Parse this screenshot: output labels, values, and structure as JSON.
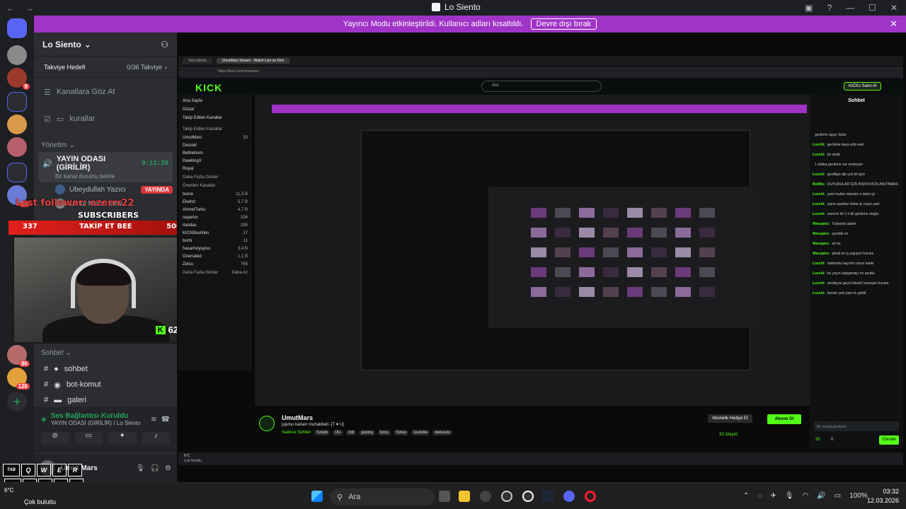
{
  "window": {
    "title": "Lo Siento",
    "nav_back": "←",
    "nav_forward": "→"
  },
  "banner": {
    "text": "Yayıncı Modu etkinleştirildi. Kullanıcı adları kısaltıldı.",
    "button": "Devre dışı bırak",
    "close": "✕"
  },
  "server": {
    "name": "Lo Siento",
    "boost_goal": "Takviye Hedefi",
    "boost_count": "0/36 Takviye",
    "browse_channels": "Kanallara Göz At",
    "rules_channel": "kurallar",
    "category_admin": "Yönetim",
    "voice_channel": "YAYIN ODASI (GİRİLİR)",
    "voice_timer": "9:11:26",
    "voice_status": "Bir kanal durumu belirle",
    "members": [
      {
        "name": "Ubeydullah Yazıcı",
        "badge": "YAYINDA"
      },
      {
        "name": "Umut Mars",
        "badge": "BMW"
      }
    ],
    "category_chat": "Sohbet",
    "text_channels": [
      "sohbet",
      "bot-komut",
      "galeri"
    ]
  },
  "voice_connection": {
    "status": "Ses Bağlantısı Kuruldu",
    "location": "YAYIN ODASI (GİRİLİR) / Lo Siento"
  },
  "user_panel": {
    "name": "Umut Mars",
    "status": "Çok bulutlu"
  },
  "overlay": {
    "last_follower": "Last follower: ozerrr22",
    "subscribers_label": "SUBSCRIBERS",
    "sub_count": "337",
    "follow_goal_label": "TAKİP ET BEE",
    "follow_goal": "500",
    "bilgi": "Bilgi",
    "kick_viewers": "62"
  },
  "kick": {
    "tab1": "Yeni sekme",
    "tab2": "UmutMars Stream - Watch Live on Kick",
    "url": "https://kick.com/umutmars",
    "logo": "KICK",
    "search_placeholder": "Ara",
    "nav": [
      "Ana Sayfa",
      "Gözat",
      "Takip Edilen Kanallar"
    ],
    "followed_header": "Takip Edilen Kanallar",
    "followed": [
      {
        "name": "UmutMars",
        "sub": "Sadece Sohbet",
        "count": "33"
      },
      {
        "name": "Dessiel",
        "sub": "",
        "count": ""
      },
      {
        "name": "Bethlehem",
        "sub": "",
        "count": ""
      },
      {
        "name": "DwellingX",
        "sub": "",
        "count": ""
      },
      {
        "name": "Royal",
        "sub": "",
        "count": ""
      }
    ],
    "more": "Daha Fazla Göster",
    "recommended_header": "Önerilen Kanallar",
    "recommended": [
      {
        "name": "burce",
        "sub": "Sadece Sohbet",
        "count": "11,3 B"
      },
      {
        "name": "Elwind",
        "sub": "League of Legends",
        "count": "5,7 B"
      },
      {
        "name": "AhmetTurku",
        "sub": "Grand Theft Auto V",
        "count": "4,7 B"
      },
      {
        "name": "superior",
        "sub": "PUBG: Battlegrounds",
        "count": "334"
      },
      {
        "name": "rlandas",
        "sub": "",
        "count": "285"
      },
      {
        "name": "KICKBounties",
        "sub": "KICK Bounties",
        "count": "17"
      },
      {
        "name": "burhi",
        "sub": "Resident Evil Requiem",
        "count": "11"
      },
      {
        "name": "hasamviyuyivu",
        "sub": "Counter-Strike 2",
        "count": "3,4 B"
      },
      {
        "name": "Overrated",
        "sub": "Teamfight Tactics",
        "count": "1,1 B"
      },
      {
        "name": "Zetsu",
        "sub": "Sadece Sohbet",
        "count": "765"
      }
    ],
    "less": "Daha Fazla Göster",
    "less2": "Daha Az",
    "kicks_button": "KICKs Satın Al",
    "streamer": "UmutMars",
    "stream_title": "jujutsu kaisen muhabbeti -[T ♥ U]",
    "category": "Sadece Sohbet",
    "tags": [
      "Turkish",
      "18+",
      "chill",
      "gaming",
      "funny",
      "Türkçe",
      "Soulslike",
      "darksouls"
    ],
    "viewers": "33 İzleyici",
    "gift_button": "Abonelik Hediye Et",
    "subscribe_button": "Abone Ol",
    "chat_header": "Sohbet",
    "chat": [
      {
        "user": "",
        "msg": "gecikme aşşırı fazla"
      },
      {
        "user": "Loschi:",
        "msg": "geckime baya arttı evet"
      },
      {
        "user": "Loschi:",
        "msg": "bir anda"
      },
      {
        "user": "",
        "msg": "1 dakka gecikme var nerdeyse"
      },
      {
        "user": "Loschi:",
        "msg": "goodbye dip çok bil şiyo"
      },
      {
        "user": "BotRix:",
        "msg": "DUYURULAR İÇİN İNSYA KİCKUMUTMARS"
      },
      {
        "user": "Loschi:",
        "msg": "yarın kullan istersen o daha iyi"
      },
      {
        "user": "Loschi:",
        "msg": "yayın açarken daha iyi oluyo yani"
      },
      {
        "user": "Loschi:",
        "msg": "sanırım iki 2 3 dk gecikme oluştu"
      },
      {
        "user": "Wesspiez:",
        "msg": "Türkselci adam"
      },
      {
        "user": "Wesspiez:",
        "msg": "ayrıldık mı"
      },
      {
        "user": "Wesspiez:",
        "msg": "ah ke"
      },
      {
        "user": "Wesspiez:",
        "msg": "şimdi ne iş yapıyon hocam"
      },
      {
        "user": "Loschi:",
        "msg": "hakkında hayırlısı olsun kanki"
      },
      {
        "user": "Loschi:",
        "msg": "bu yayın kapşamayı mı unuttu"
      },
      {
        "user": "Loschi:",
        "msg": "nerdeyse geçiri bleach konuşan hocam"
      },
      {
        "user": "Loschi:",
        "msg": "boruto yeni part mı gelidi"
      }
    ],
    "chat_input": "Bir mesaj gönderin",
    "send": "Gönder",
    "points": "30",
    "kicks": "0"
  },
  "taskbar": {
    "search": "Ara",
    "time": "03:32",
    "date": "12.03.2026",
    "battery": "100%",
    "weather_temp": "6°C",
    "weather": "Çok bulutlu"
  },
  "keyboard": {
    "row1": [
      "TAB",
      "Q",
      "W",
      "E",
      "R"
    ],
    "row2": [
      "CAPS",
      "A",
      "S",
      "D",
      "F"
    ],
    "row3": [
      "SHIFT",
      "Z",
      "X",
      "C",
      "V"
    ]
  }
}
